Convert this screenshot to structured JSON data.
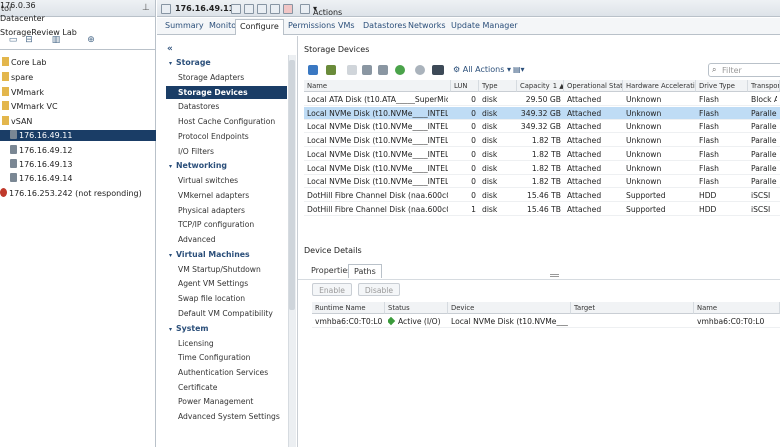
{
  "navigator": {
    "title": "tor",
    "tree": [
      {
        "label": "176.0.36",
        "indent": 0,
        "icon": "none"
      },
      {
        "label": "Datacenter",
        "indent": 0,
        "icon": "none"
      },
      {
        "label": "StorageReview Lab",
        "indent": 0,
        "icon": "none"
      },
      {
        "label": "Core Lab",
        "indent": 1,
        "icon": "folder-icon"
      },
      {
        "label": "spare",
        "indent": 1,
        "icon": "folder-icon"
      },
      {
        "label": "VMmark",
        "indent": 1,
        "icon": "folder-icon"
      },
      {
        "label": "VMmark VC",
        "indent": 1,
        "icon": "folder-icon"
      },
      {
        "label": "vSAN",
        "indent": 1,
        "icon": "folder-icon"
      },
      {
        "label": "176.16.49.11",
        "indent": 2,
        "icon": "host-icon",
        "selected": true
      },
      {
        "label": "176.16.49.12",
        "indent": 2,
        "icon": "host-icon"
      },
      {
        "label": "176.16.49.13",
        "indent": 2,
        "icon": "host-icon"
      },
      {
        "label": "176.16.49.14",
        "indent": 2,
        "icon": "host-icon"
      },
      {
        "label": "176.16.253.242 (not responding)",
        "indent": 0,
        "icon": "warning-icon"
      }
    ]
  },
  "header": {
    "host": "176.16.49.11",
    "actions_label": "Actions"
  },
  "tabs": [
    "Summary",
    "Monitor",
    "Configure",
    "Permissions",
    "VMs",
    "Datastores",
    "Networks",
    "Update Manager"
  ],
  "active_tab": "Configure",
  "config_menu": {
    "collapse_glyph": "«",
    "sections": [
      {
        "title": "Storage",
        "items": [
          "Storage Adapters",
          "Storage Devices",
          "Datastores",
          "Host Cache Configuration",
          "Protocol Endpoints",
          "I/O Filters"
        ]
      },
      {
        "title": "Networking",
        "items": [
          "Virtual switches",
          "VMkernel adapters",
          "Physical adapters",
          "TCP/IP configuration",
          "Advanced"
        ]
      },
      {
        "title": "Virtual Machines",
        "items": [
          "VM Startup/Shutdown",
          "Agent VM Settings",
          "Swap file location",
          "Default VM Compatibility"
        ]
      },
      {
        "title": "System",
        "items": [
          "Licensing",
          "Time Configuration",
          "Authentication Services",
          "Certificate",
          "Power Management",
          "Advanced System Settings"
        ]
      }
    ],
    "selected_item": "Storage Devices"
  },
  "storage_devices": {
    "title": "Storage Devices",
    "all_actions_label": "All Actions",
    "filter_placeholder": "Filter",
    "columns": [
      "Name",
      "LUN",
      "Type",
      "Capacity",
      "Operational State",
      "Hardware Acceleration",
      "Drive Type",
      "Transport"
    ],
    "sort_indicator": "1 ▲",
    "rows": [
      {
        "name": "Local ATA Disk (t10.ATA_____SuperMicr...",
        "lun": "0",
        "type": "disk",
        "capacity": "29.50 GB",
        "state": "Attached",
        "hw": "Unknown",
        "drive": "Flash",
        "transport": "Block Ada"
      },
      {
        "name": "Local NVMe Disk (t10.NVMe____INTEL...",
        "lun": "0",
        "type": "disk",
        "capacity": "349.32 GB",
        "state": "Attached",
        "hw": "Unknown",
        "drive": "Flash",
        "transport": "Parallel S",
        "selected": true
      },
      {
        "name": "Local NVMe Disk (t10.NVMe____INTEL...",
        "lun": "0",
        "type": "disk",
        "capacity": "349.32 GB",
        "state": "Attached",
        "hw": "Unknown",
        "drive": "Flash",
        "transport": "Parallel S"
      },
      {
        "name": "Local NVMe Disk (t10.NVMe____INTEL...",
        "lun": "0",
        "type": "disk",
        "capacity": "1.82 TB",
        "state": "Attached",
        "hw": "Unknown",
        "drive": "Flash",
        "transport": "Parallel S"
      },
      {
        "name": "Local NVMe Disk (t10.NVMe____INTEL...",
        "lun": "0",
        "type": "disk",
        "capacity": "1.82 TB",
        "state": "Attached",
        "hw": "Unknown",
        "drive": "Flash",
        "transport": "Parallel S"
      },
      {
        "name": "Local NVMe Disk (t10.NVMe____INTEL...",
        "lun": "0",
        "type": "disk",
        "capacity": "1.82 TB",
        "state": "Attached",
        "hw": "Unknown",
        "drive": "Flash",
        "transport": "Parallel S"
      },
      {
        "name": "Local NVMe Disk (t10.NVMe____INTEL...",
        "lun": "0",
        "type": "disk",
        "capacity": "1.82 TB",
        "state": "Attached",
        "hw": "Unknown",
        "drive": "Flash",
        "transport": "Parallel S"
      },
      {
        "name": "DotHill Fibre Channel Disk (naa.600c0ff0...",
        "lun": "0",
        "type": "disk",
        "capacity": "15.46 TB",
        "state": "Attached",
        "hw": "Supported",
        "drive": "HDD",
        "transport": "iSCSI"
      },
      {
        "name": "DotHill Fibre Channel Disk (naa.600c0ff0...",
        "lun": "1",
        "type": "disk",
        "capacity": "15.46 TB",
        "state": "Attached",
        "hw": "Supported",
        "drive": "HDD",
        "transport": "iSCSI"
      }
    ]
  },
  "device_details": {
    "title": "Device Details",
    "tabs": [
      "Properties",
      "Paths"
    ],
    "active_tab": "Paths",
    "enable_label": "Enable",
    "disable_label": "Disable",
    "columns": [
      "Runtime Name",
      "Status",
      "Device",
      "Target",
      "Name"
    ],
    "rows": [
      {
        "runtime": "vmhba6:C0:T0:L0",
        "status": "Active (I/O)",
        "device": "Local NVMe Disk (t10.NVMe____...",
        "target": "",
        "name": "vmhba6:C0:T0:L0"
      }
    ]
  }
}
